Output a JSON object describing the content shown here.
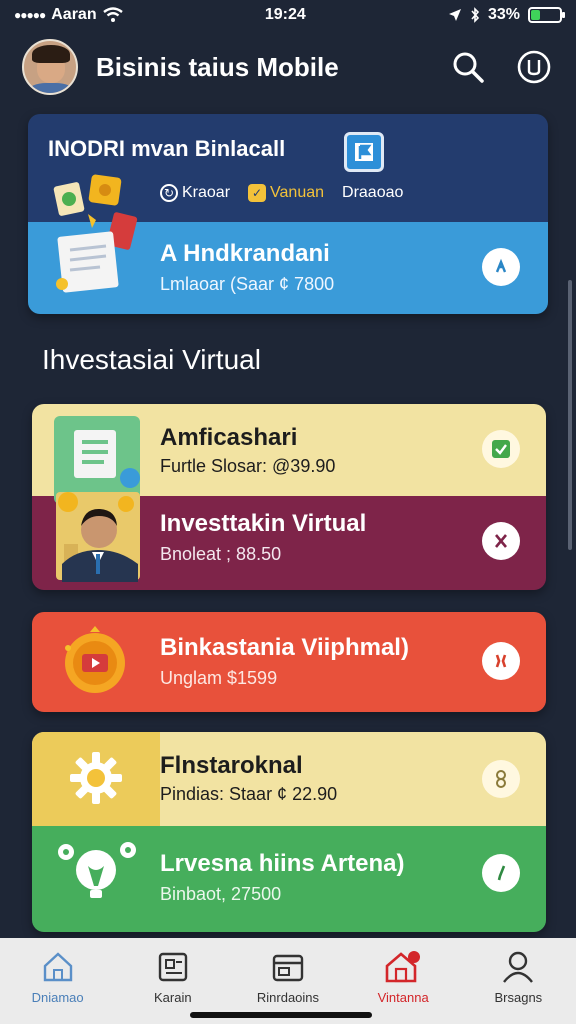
{
  "status_bar": {
    "carrier": "Aaran",
    "time": "19:24",
    "battery": "33%",
    "battery_level": 0.33
  },
  "header": {
    "title": "Bisinis taius Mobile",
    "search_icon": "search-icon",
    "power_icon": "power-icon"
  },
  "top_card": {
    "title": "INODRI mvan Binlacall",
    "tabs": [
      {
        "label": "Kraoar",
        "icon": "refresh-icon"
      },
      {
        "label": "Vanuan",
        "icon": "checkbox-icon"
      },
      {
        "label": "Draaoao",
        "icon": ""
      }
    ],
    "item": {
      "title": "A Hndkrandani",
      "subtitle": "Lmlaoar (Saar ¢ 7800",
      "icon": "info-icon"
    }
  },
  "section": {
    "title": "Ihvestasiai Virtual"
  },
  "cards": [
    {
      "rows": [
        {
          "title": "Amficashari",
          "subtitle": "Furtle Slosar: @39.90",
          "icon": "check-icon"
        },
        {
          "title": "Investtakin Virtual",
          "subtitle": "Bnoleat ; 88.50",
          "icon": "close-icon"
        }
      ]
    },
    {
      "rows": [
        {
          "title": "Binkastania Viiphmal)",
          "subtitle": "Unglam $1599",
          "icon": "pause-icon"
        }
      ]
    },
    {
      "rows": [
        {
          "title": "Flnstaroknal",
          "subtitle": "Pindias: Staar ¢ 22.90",
          "icon": "number-icon"
        },
        {
          "title": "Lrvesna hiins Artena)",
          "subtitle": "Binbaot, 27500",
          "icon": "edit-icon"
        }
      ]
    }
  ],
  "colors": {
    "background": "#1e2636",
    "accent_active": "#d3262a"
  },
  "bottom_nav": [
    {
      "label": "Dniamao",
      "icon": "home-icon"
    },
    {
      "label": "Karain",
      "icon": "wallet-icon"
    },
    {
      "label": "Rinrdaoins",
      "icon": "card-icon"
    },
    {
      "label": "Vintanna",
      "icon": "store-icon",
      "active": true
    },
    {
      "label": "Brsagns",
      "icon": "profile-icon"
    }
  ]
}
